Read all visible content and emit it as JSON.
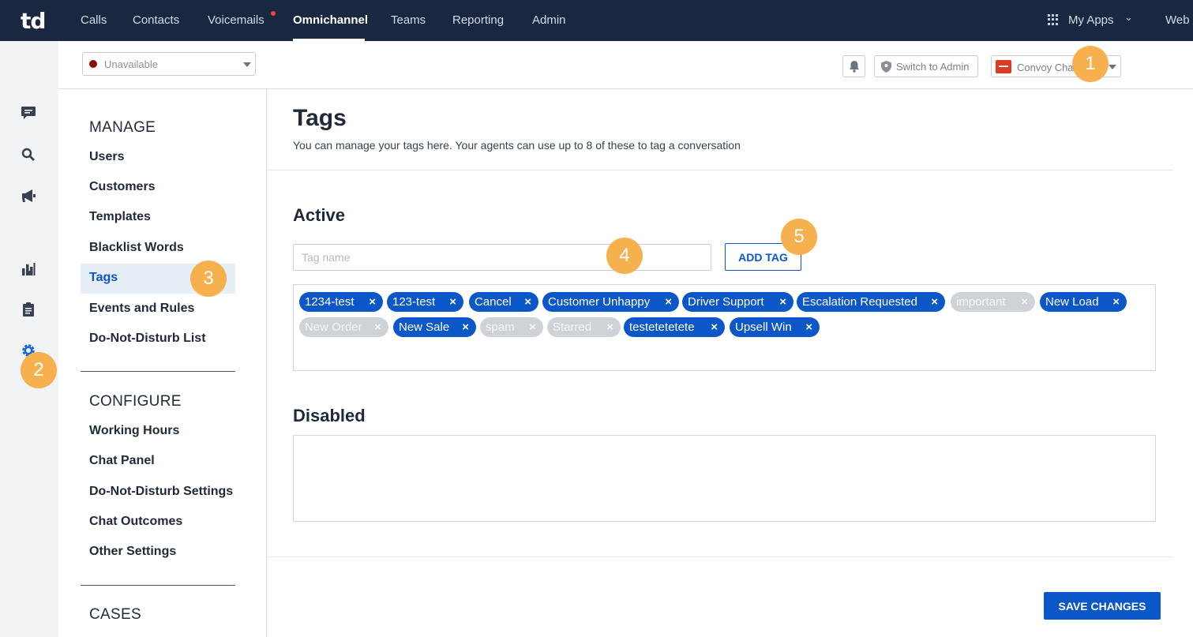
{
  "app": {
    "logo": "td"
  },
  "nav": {
    "items": [
      "Calls",
      "Contacts",
      "Voicemails",
      "Omnichannel",
      "Teams",
      "Reporting",
      "Admin"
    ],
    "my_apps": "My Apps",
    "web": "Web"
  },
  "status": {
    "value": "Unavailable",
    "color": "#8b0d0d"
  },
  "header": {
    "switch_admin": "Switch to Admin",
    "workspace": "Convoy Chat"
  },
  "callouts": [
    "1",
    "2",
    "3",
    "4",
    "5"
  ],
  "sidebar": {
    "manage_title": "MANAGE",
    "manage": [
      "Users",
      "Customers",
      "Templates",
      "Blacklist Words",
      "Tags",
      "Events and Rules",
      "Do-Not-Disturb List"
    ],
    "configure_title": "CONFIGURE",
    "configure": [
      "Working Hours",
      "Chat Panel",
      "Do-Not-Disturb Settings",
      "Chat Outcomes",
      "Other Settings"
    ],
    "cases_title": "CASES"
  },
  "main": {
    "title": "Tags",
    "subtitle": "You can manage your tags here. Your agents can use up to 8 of these to tag a conversation",
    "active_heading": "Active",
    "tag_placeholder": "Tag name",
    "add_tag": "ADD TAG",
    "disabled_heading": "Disabled",
    "save": "SAVE CHANGES",
    "tags": [
      {
        "label": "1234-test",
        "enabled": true
      },
      {
        "label": "123-test",
        "enabled": true
      },
      {
        "label": "Cancel",
        "enabled": true
      },
      {
        "label": "Customer Unhappy",
        "enabled": true
      },
      {
        "label": "Driver Support",
        "enabled": true
      },
      {
        "label": "Escalation Requested",
        "enabled": true
      },
      {
        "label": "important",
        "enabled": false
      },
      {
        "label": "New Load",
        "enabled": true
      },
      {
        "label": "New Order",
        "enabled": false
      },
      {
        "label": "New Sale",
        "enabled": true
      },
      {
        "label": "spam",
        "enabled": false
      },
      {
        "label": "Starred",
        "enabled": false
      },
      {
        "label": "testetetetete",
        "enabled": true
      },
      {
        "label": "Upsell Win",
        "enabled": true
      }
    ],
    "remove_glyph": "×"
  },
  "colors": {
    "nav_bg": "#1a2740",
    "primary": "#0b57c7",
    "callout": "#f6b04e",
    "chip_disabled": "#cfd2d6"
  }
}
